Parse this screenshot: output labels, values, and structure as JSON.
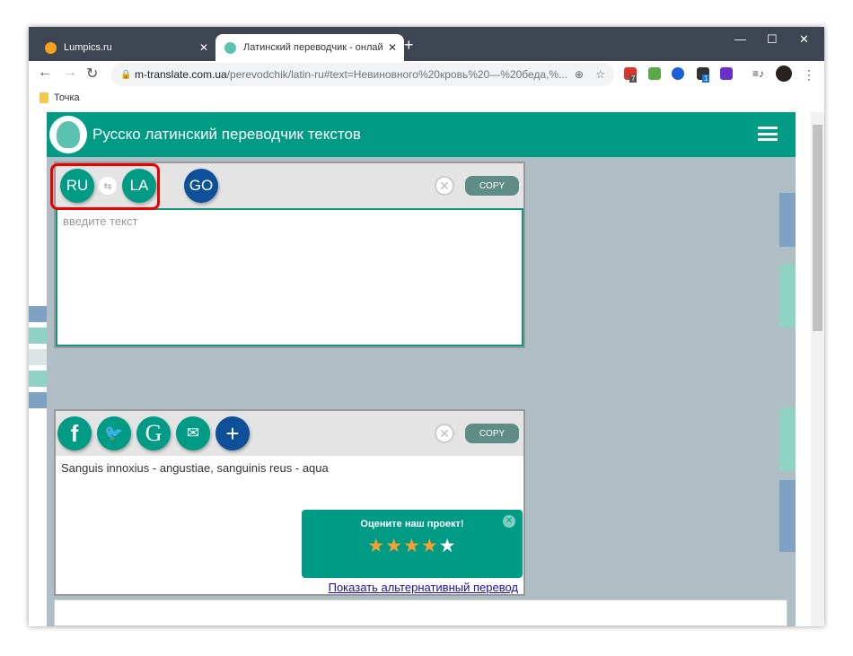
{
  "browser": {
    "tabs": [
      {
        "label": "Lumpics.ru",
        "active": false
      },
      {
        "label": "Латинский переводчик - онлай",
        "active": true
      }
    ],
    "url_host": "m-translate.com.ua",
    "url_rest": "/perevodchik/latin-ru#text=Невиновного%20кровь%20—%20беда,%...",
    "bookmark": "Точка",
    "ext_badges": [
      "7",
      "1"
    ]
  },
  "header": {
    "title": "Русско латинский переводчик текстов"
  },
  "source": {
    "from": "RU",
    "to": "LA",
    "go": "GO",
    "copy": "COPY",
    "placeholder": "введите текст"
  },
  "output": {
    "text": "Sanguis innoxius - angustiae, sanguinis reus - aqua",
    "copy": "COPY",
    "alt_link": "Показать альтернативный перевод"
  },
  "rating": {
    "title": "Оцените наш проект!",
    "stars": 4,
    "max": 5
  },
  "colors": {
    "brand": "#009b84",
    "go": "#0d4f98",
    "highlight": "#e00000"
  }
}
